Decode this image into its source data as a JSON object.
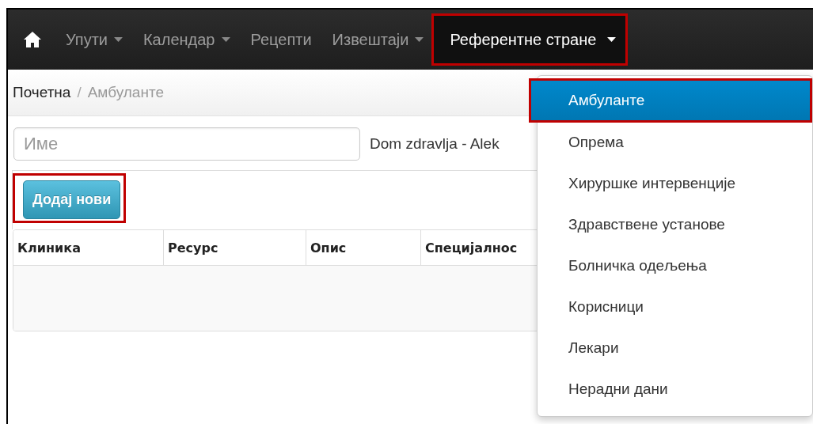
{
  "nav": {
    "items": [
      {
        "label": "Упути",
        "has_caret": true,
        "selected": false,
        "highlighted": false
      },
      {
        "label": "Календар",
        "has_caret": true,
        "selected": false,
        "highlighted": false
      },
      {
        "label": "Рецепти",
        "has_caret": false,
        "selected": false,
        "highlighted": false
      },
      {
        "label": "Извештаји",
        "has_caret": true,
        "selected": false,
        "highlighted": false
      },
      {
        "label": "Референтне стране",
        "has_caret": true,
        "selected": true,
        "highlighted": true
      }
    ]
  },
  "breadcrumb": {
    "separator": "/",
    "items": [
      {
        "label": "Почетна",
        "current": false
      },
      {
        "label": "Амбуланте",
        "current": true
      }
    ]
  },
  "filter": {
    "placeholder": "Име",
    "facility": "Dom zdravlja - Alek"
  },
  "add_button": {
    "label": "Додај нови",
    "highlighted": true
  },
  "table": {
    "columns": [
      "Клиника",
      "Ресурс",
      "Опис",
      "Специјалнос"
    ]
  },
  "dropdown": {
    "items": [
      {
        "label": "Амбуланте",
        "selected": true,
        "highlighted": true
      },
      {
        "label": "Опрема",
        "selected": false,
        "highlighted": false
      },
      {
        "label": "Хируршке интервенције",
        "selected": false,
        "highlighted": false
      },
      {
        "label": "Здравствене установе",
        "selected": false,
        "highlighted": false
      },
      {
        "label": "Болничка одељења",
        "selected": false,
        "highlighted": false
      },
      {
        "label": "Корисници",
        "selected": false,
        "highlighted": false
      },
      {
        "label": "Лекари",
        "selected": false,
        "highlighted": false
      },
      {
        "label": "Нерадни дани",
        "selected": false,
        "highlighted": false
      }
    ]
  }
}
